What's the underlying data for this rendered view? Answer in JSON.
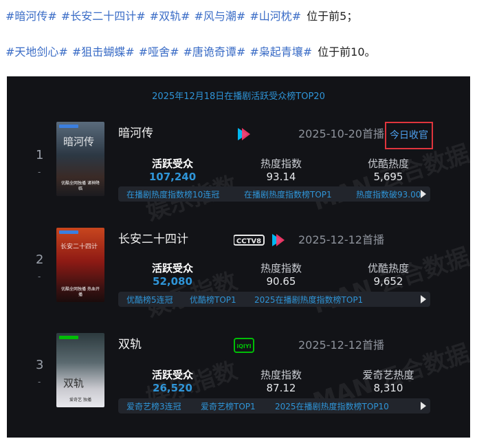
{
  "intro": {
    "line1": {
      "tags": [
        "#暗河传#",
        "#长安二十四计#",
        "#双轨#",
        "#风与潮#",
        "#山河枕#"
      ],
      "suffix": "位于前5；"
    },
    "line2": {
      "tags": [
        "#天地剑心#",
        "#狙击蝴蝶#",
        "#哑舍#",
        "#唐诡奇谭#",
        "#枭起青壤#"
      ],
      "suffix": "位于前10。"
    }
  },
  "chart": {
    "title": "2025年12月18日在播剧活跃受众榜TOP20",
    "watermark": "MAN 云合数据",
    "watermark2": "娱乐指数",
    "colors": {
      "accent": "#2f95d8",
      "youku": "#e0353d",
      "iqiyi": "#00be06",
      "cctv": "#c40018"
    },
    "items": [
      {
        "rank": "1",
        "rank_sub": "-",
        "title": "暗河传",
        "poster_title": "暗河传",
        "poster_note": "优酷全网独播 诸神降临",
        "platform_icon": "youku-logo",
        "date": "2025-10-20首播",
        "today": "今日收官",
        "metrics": [
          {
            "label": "活跃受众",
            "value": "107,240"
          },
          {
            "label": "热度指数",
            "value": "93.14"
          },
          {
            "label": "优酷热度",
            "value": "5,695"
          }
        ],
        "honors": [
          "在播剧热度指数榜10连冠",
          "在播剧热度指数榜TOP1",
          "热度指数破93.00"
        ]
      },
      {
        "rank": "2",
        "rank_sub": "-",
        "title": "长安二十四计",
        "poster_title": "长安二十四计",
        "poster_note": "优酷全网独播 热血开播",
        "platform_icon": "cctv8-logo",
        "platform_text": "CCTV8",
        "date": "2025-12-12首播",
        "metrics": [
          {
            "label": "活跃受众",
            "value": "52,080"
          },
          {
            "label": "热度指数",
            "value": "90.65"
          },
          {
            "label": "优酷热度",
            "value": "9,652"
          }
        ],
        "honors": [
          "优酷榜5连冠",
          "优酷榜TOP1",
          "2025在播剧热度指数榜TOP1"
        ]
      },
      {
        "rank": "3",
        "rank_sub": "-",
        "title": "双轨",
        "poster_title": "双轨",
        "poster_note": "爱奇艺 独播",
        "platform_icon": "iqiyi-logo",
        "platform_text": "iQIYI",
        "date": "2025-12-12首播",
        "metrics": [
          {
            "label": "活跃受众",
            "value": "26,520"
          },
          {
            "label": "热度指数",
            "value": "87.12"
          },
          {
            "label": "爱奇艺热度",
            "value": "8,310"
          }
        ],
        "honors": [
          "爱奇艺榜3连冠",
          "爱奇艺榜TOP1",
          "2025在播剧热度指数榜TOP10"
        ]
      }
    ]
  }
}
